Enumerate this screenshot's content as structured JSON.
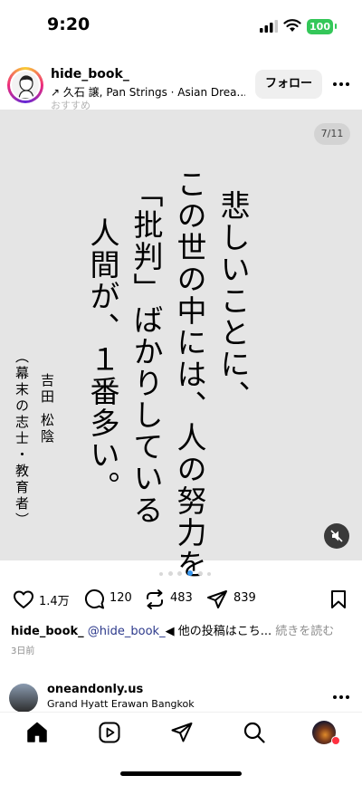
{
  "status_bar": {
    "time": "9:20",
    "battery": "100"
  },
  "header": {
    "username": "hide_book_",
    "music": "↗ 久石 譲, Pan Strings · Asian Drea...",
    "suggested": "おすすめ",
    "follow_label": "フォロー"
  },
  "post": {
    "counter": "7/11",
    "lines": [
      "悲しいことに、",
      "この世の中には、人の努力を",
      "「批判」ばかりしている",
      "人間が、１番多い。"
    ],
    "author_name": "吉田 松陰",
    "author_title": "（幕末の志士・教育者）"
  },
  "actions": {
    "likes": "1.4万",
    "comments": "120",
    "reposts": "483",
    "shares": "839"
  },
  "caption": {
    "username": "hide_book_",
    "mention": "@hide_book_",
    "text": "◀ 他の投稿はこち...",
    "read_more": "続きを読む"
  },
  "date": "3日前",
  "next_post": {
    "username": "oneandonly.us",
    "location": "Grand Hyatt Erawan Bangkok"
  },
  "colors": {
    "accent_green": "#34c759",
    "mention_blue": "#2d3a8c",
    "post_bg": "#e5e5e5"
  },
  "icons": [
    "signal-icon",
    "wifi-icon",
    "battery-icon",
    "more-icon",
    "mute-icon",
    "heart-icon",
    "comment-icon",
    "repost-icon",
    "share-icon",
    "bookmark-icon",
    "home-icon",
    "reels-icon",
    "send-icon",
    "search-icon",
    "profile-avatar"
  ]
}
